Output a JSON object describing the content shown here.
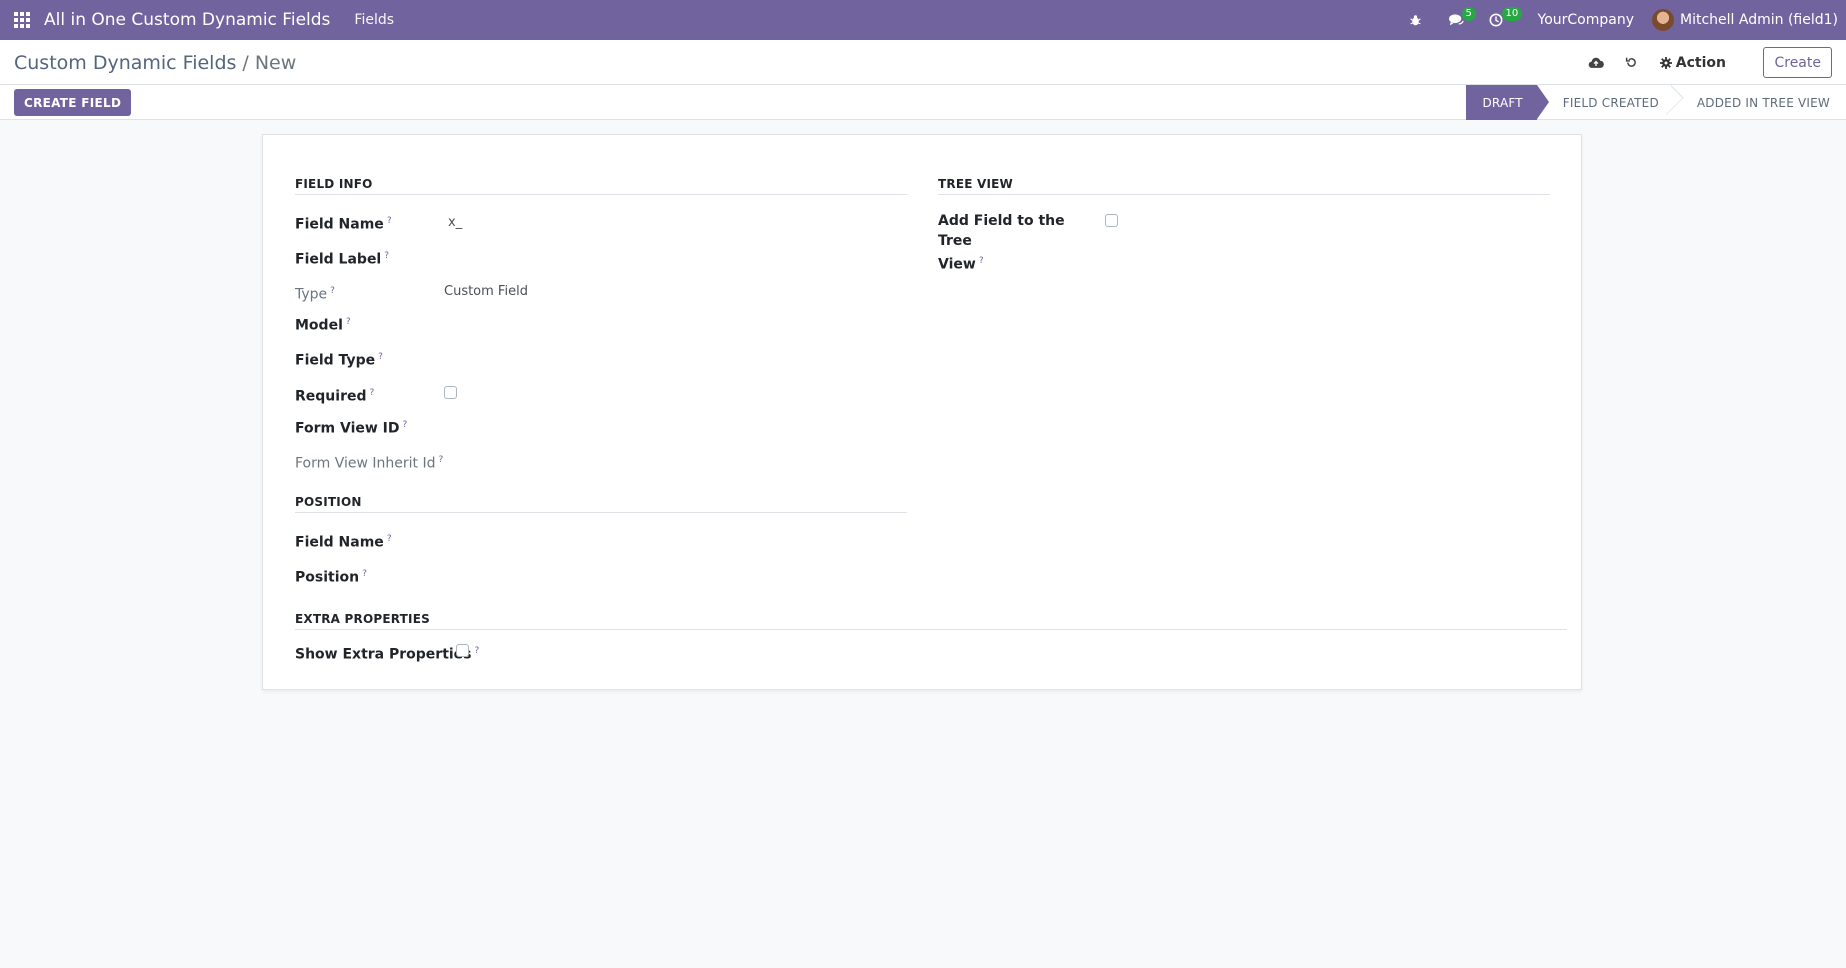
{
  "navbar": {
    "apps_icon": "grid-icon",
    "app_title": "All in One Custom Dynamic Fields",
    "menu_fields": "Fields",
    "messages_badge": "5",
    "activities_badge": "10",
    "company": "YourCompany",
    "user": "Mitchell Admin (field1)"
  },
  "control": {
    "breadcrumb_parent": "Custom Dynamic Fields",
    "breadcrumb_sep": "/",
    "breadcrumb_current": "New",
    "action_label": "Action",
    "create_label": "Create"
  },
  "statusbar": {
    "create_field_label": "CREATE FIELD",
    "stages": [
      "DRAFT",
      "FIELD CREATED",
      "ADDED IN TREE VIEW"
    ],
    "active_stage": "DRAFT"
  },
  "form": {
    "field_info": {
      "title": "FIELD INFO",
      "field_name_label": "Field Name",
      "field_name_value": "x_",
      "field_label_label": "Field Label",
      "type_label": "Type",
      "type_value": "Custom Field",
      "model_label": "Model",
      "field_type_label": "Field Type",
      "required_label": "Required",
      "required_checked": false,
      "form_view_id_label": "Form View ID",
      "form_view_inherit_label": "Form View Inherit Id"
    },
    "tree_view": {
      "title": "TREE VIEW",
      "add_field_label_line1": "Add Field to the Tree",
      "add_field_label_line2": "View",
      "add_field_checked": false
    },
    "position": {
      "title": "POSITION",
      "field_name_label": "Field Name",
      "position_label": "Position"
    },
    "extra": {
      "title": "EXTRA PROPERTIES",
      "show_extra_label": "Show Extra Properties",
      "show_extra_checked": false
    },
    "help_mark": "?"
  },
  "colors": {
    "brand": "#71639e",
    "badge": "#28a745"
  }
}
